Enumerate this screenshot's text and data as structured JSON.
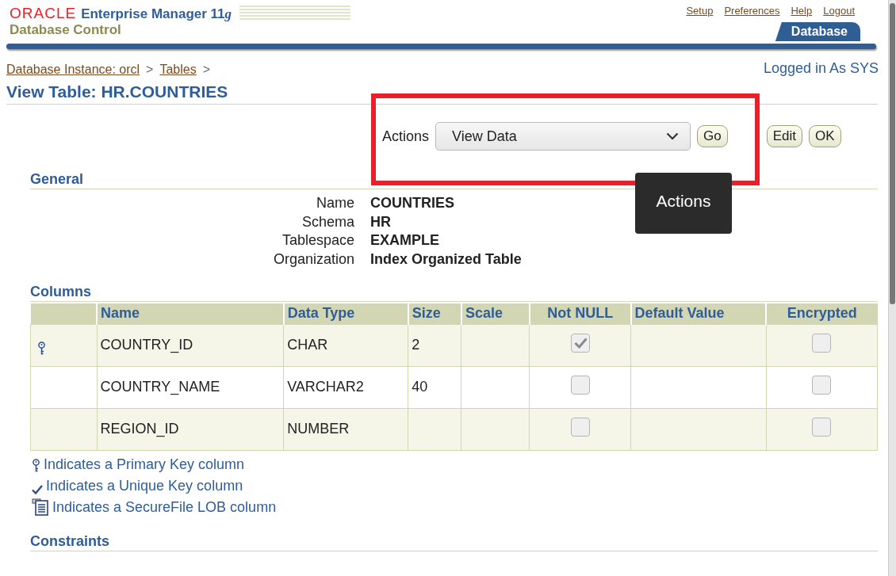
{
  "header": {
    "brand": "ORACLE",
    "product": "Enterprise Manager 11",
    "product_suffix": "g",
    "subtitle": "Database Control",
    "links": [
      "Setup",
      "Preferences",
      "Help",
      "Logout"
    ],
    "tabs": [
      {
        "label": "Database",
        "selected": true
      }
    ]
  },
  "breadcrumb": {
    "items": [
      "Database Instance: orcl",
      "Tables"
    ],
    "separator": ">"
  },
  "login_status": "Logged in As SYS",
  "page_title": "View Table: HR.COUNTRIES",
  "actions": {
    "label": "Actions",
    "value": "View Data",
    "go": "Go",
    "buttons": [
      "Edit",
      "OK"
    ]
  },
  "tooltip": "Actions",
  "general": {
    "heading": "General",
    "properties": [
      {
        "label": "Name",
        "value": "COUNTRIES"
      },
      {
        "label": "Schema",
        "value": "HR"
      },
      {
        "label": "Tablespace",
        "value": "EXAMPLE"
      },
      {
        "label": "Organization",
        "value": "Index Organized Table"
      }
    ]
  },
  "columns": {
    "heading": "Columns",
    "headers": [
      "Name",
      "Data Type",
      "Size",
      "Scale",
      "Not NULL",
      "Default Value",
      "Encrypted"
    ],
    "rows": [
      {
        "primary_key": true,
        "name": "COUNTRY_ID",
        "data_type": "CHAR",
        "size": "2",
        "not_null": true,
        "encrypted": false
      },
      {
        "primary_key": false,
        "name": "COUNTRY_NAME",
        "data_type": "VARCHAR2",
        "size": "40",
        "not_null": false,
        "encrypted": false
      },
      {
        "primary_key": false,
        "name": "REGION_ID",
        "data_type": "NUMBER",
        "not_null": false,
        "encrypted": false
      }
    ],
    "legend": [
      {
        "kind": "primary-key",
        "text": "Indicates a Primary Key column"
      },
      {
        "kind": "unique-key",
        "text": "Indicates a Unique Key column"
      },
      {
        "kind": "securefile",
        "text": "Indicates a SecureFile LOB column"
      }
    ]
  },
  "constraints": {
    "heading": "Constraints"
  }
}
